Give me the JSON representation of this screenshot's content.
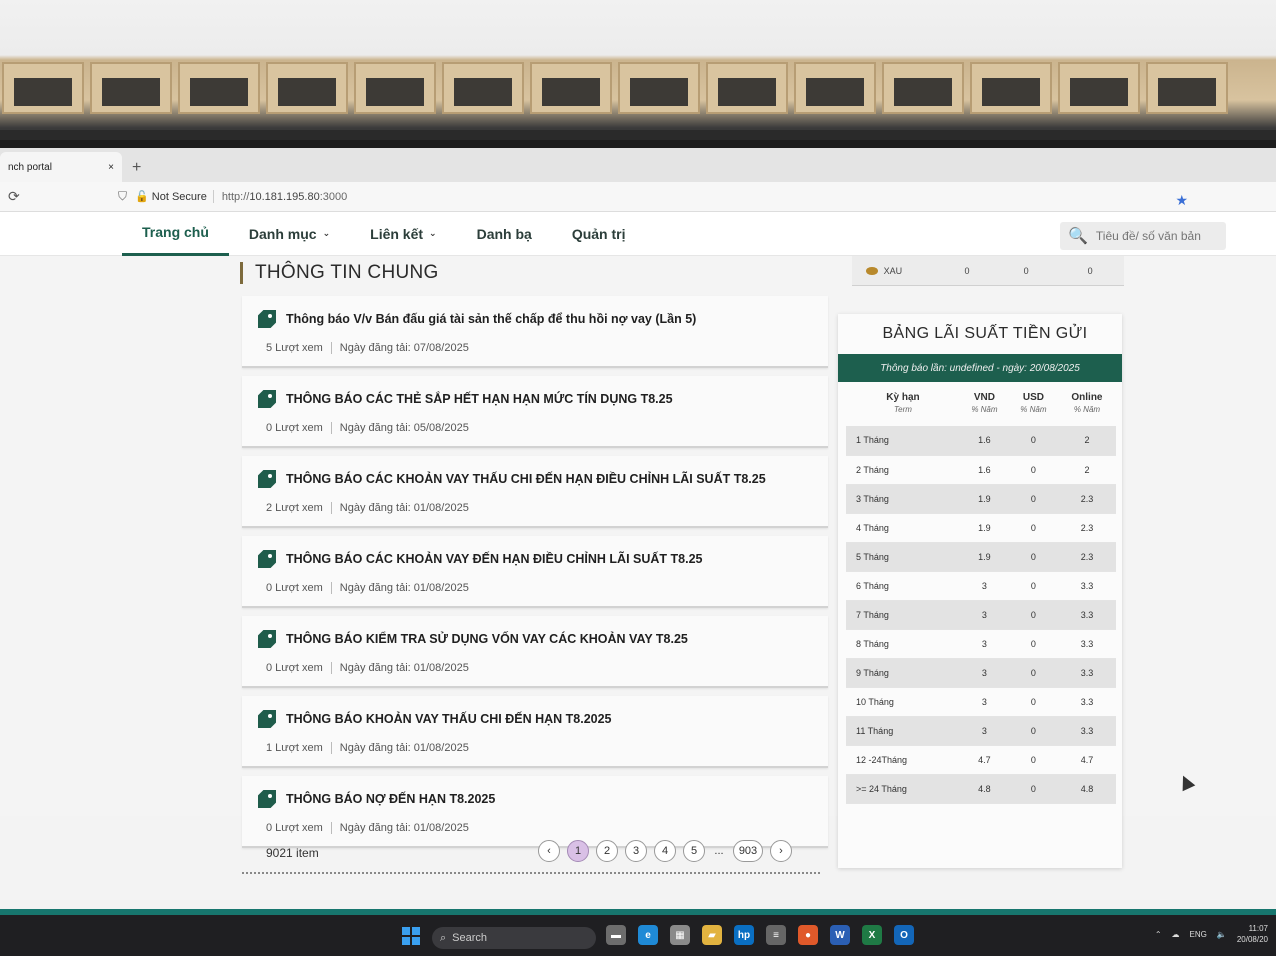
{
  "browser": {
    "tab_title": "nch portal",
    "tab_close": "×",
    "new_tab": "+",
    "reload": "C",
    "security_label": "Not Secure",
    "url_prefix": "http://",
    "url_host": "10.181.195.80",
    "url_port": ":3000"
  },
  "nav": {
    "items": [
      {
        "label": "Trang chủ",
        "active": true
      },
      {
        "label": "Danh mục",
        "dropdown": true
      },
      {
        "label": "Liên kết",
        "dropdown": true
      },
      {
        "label": "Danh bạ"
      },
      {
        "label": "Quản trị"
      }
    ],
    "search_placeholder": "Tiêu đề/ số văn bản"
  },
  "section_title": "THÔNG TIN CHUNG",
  "news": [
    {
      "title": "Thông báo V/v Bán đấu giá tài sản thế chấp để thu hồi nợ vay (Lần 5)",
      "views": "5 Lượt xem",
      "date": "Ngày đăng tải: 07/08/2025"
    },
    {
      "title": "THÔNG BÁO CÁC THẺ SẮP HẾT HẠN HẠN MỨC TÍN DỤNG T8.25",
      "views": "0 Lượt xem",
      "date": "Ngày đăng tải: 05/08/2025"
    },
    {
      "title": "THÔNG BÁO CÁC KHOẢN VAY THẤU CHI ĐẾN HẠN ĐIỀU CHỈNH LÃI SUẤT T8.25",
      "views": "2 Lượt xem",
      "date": "Ngày đăng tải: 01/08/2025"
    },
    {
      "title": "THÔNG BÁO CÁC KHOẢN VAY ĐẾN HẠN ĐIỀU CHỈNH LÃI SUẤT T8.25",
      "views": "0 Lượt xem",
      "date": "Ngày đăng tải: 01/08/2025"
    },
    {
      "title": "THÔNG BÁO KIỂM TRA SỬ DỤNG VỐN VAY CÁC KHOẢN VAY T8.25",
      "views": "0 Lượt xem",
      "date": "Ngày đăng tải: 01/08/2025"
    },
    {
      "title": "THÔNG BÁO KHOẢN VAY THẤU CHI ĐẾN HẠN T8.2025",
      "views": "1 Lượt xem",
      "date": "Ngày đăng tải: 01/08/2025"
    },
    {
      "title": "THÔNG BÁO NỢ ĐẾN HẠN T8.2025",
      "views": "0 Lượt xem",
      "date": "Ngày đăng tải: 01/08/2025"
    }
  ],
  "pagination": {
    "item_count": "9021 item",
    "prev": "‹",
    "pages": [
      "1",
      "2",
      "3",
      "4",
      "5"
    ],
    "ellipsis": "...",
    "last": "903",
    "next": "›",
    "current": "1"
  },
  "gold": {
    "label": "XAU",
    "values": [
      "0",
      "0",
      "0"
    ]
  },
  "rates": {
    "title": "BẢNG LÃI SUẤT TIỀN GỬI",
    "notice": "Thông báo lần: undefined - ngày: 20/08/2025",
    "headers": [
      {
        "label": "Kỳ hạn",
        "sub": "Term"
      },
      {
        "label": "VND",
        "sub": "% Năm"
      },
      {
        "label": "USD",
        "sub": "% Năm"
      },
      {
        "label": "Online",
        "sub": "% Năm"
      }
    ],
    "rows": [
      [
        "1 Tháng",
        "1.6",
        "0",
        "2"
      ],
      [
        "2 Tháng",
        "1.6",
        "0",
        "2"
      ],
      [
        "3 Tháng",
        "1.9",
        "0",
        "2.3"
      ],
      [
        "4 Tháng",
        "1.9",
        "0",
        "2.3"
      ],
      [
        "5 Tháng",
        "1.9",
        "0",
        "2.3"
      ],
      [
        "6 Tháng",
        "3",
        "0",
        "3.3"
      ],
      [
        "7 Tháng",
        "3",
        "0",
        "3.3"
      ],
      [
        "8 Tháng",
        "3",
        "0",
        "3.3"
      ],
      [
        "9 Tháng",
        "3",
        "0",
        "3.3"
      ],
      [
        "10 Tháng",
        "3",
        "0",
        "3.3"
      ],
      [
        "11 Tháng",
        "3",
        "0",
        "3.3"
      ],
      [
        "12 -24Tháng",
        "4.7",
        "0",
        "4.7"
      ],
      [
        ">= 24 Tháng",
        "4.8",
        "0",
        "4.8"
      ]
    ]
  },
  "taskbar": {
    "search_label": "Search",
    "apps": [
      {
        "name": "files",
        "glyph": "▬",
        "color": "#6d6d6d"
      },
      {
        "name": "edge",
        "glyph": "e",
        "color": "#1f8ad6"
      },
      {
        "name": "store",
        "glyph": "▦",
        "color": "#8a8a8a"
      },
      {
        "name": "explorer",
        "glyph": "▰",
        "color": "#e2b340"
      },
      {
        "name": "hp",
        "glyph": "hp",
        "color": "#0a6fc2"
      },
      {
        "name": "tool",
        "glyph": "≡",
        "color": "#666"
      },
      {
        "name": "firefox",
        "glyph": "●",
        "color": "#e0592a"
      },
      {
        "name": "word",
        "glyph": "W",
        "color": "#2b5fb4"
      },
      {
        "name": "excel",
        "glyph": "X",
        "color": "#1f7a45"
      },
      {
        "name": "outlook",
        "glyph": "O",
        "color": "#1366b8"
      }
    ],
    "lang": "ENG",
    "time": "11:07",
    "date": "20/08/20"
  },
  "colors": {
    "brand": "#1d5f4e",
    "page_active": "#d9c0e6",
    "favorite_star": "#3a6fd6"
  }
}
